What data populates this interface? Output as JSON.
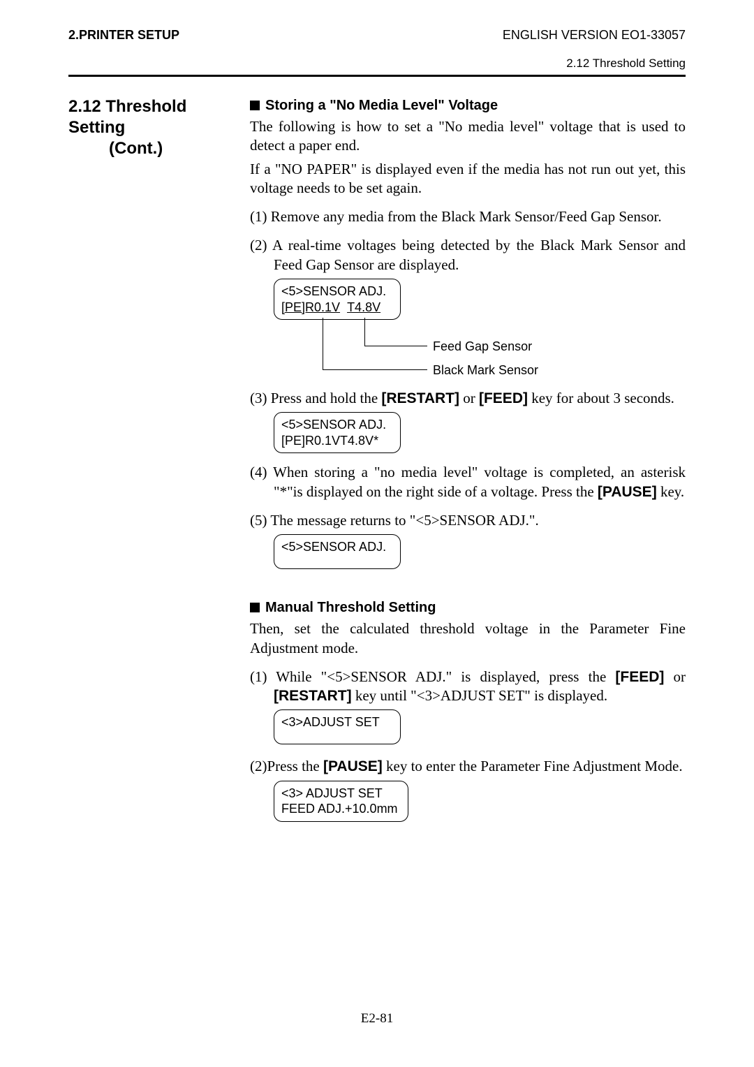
{
  "header": {
    "left": "2.PRINTER SETUP",
    "right": "ENGLISH VERSION EO1-33057",
    "sub": "2.12 Threshold Setting"
  },
  "left_col": {
    "line1": "2.12  Threshold Setting",
    "line2": "(Cont.)"
  },
  "sec1": {
    "title": "Storing a \"No Media Level\" Voltage",
    "p1": "The following is how to set a \"No media level\" voltage that is used to detect a paper end.",
    "p2": "If a \"NO PAPER\" is displayed even if the media has not run out yet, this voltage needs to be set again.",
    "s1": "(1) Remove any media from the Black Mark Sensor/Feed Gap Sensor.",
    "s2": "(2) A real-time voltages being detected by the Black Mark Sensor and Feed Gap Sensor are displayed.",
    "box2_l1": "<5>SENSOR ADJ.",
    "box2_l2a": "[PE]R0.1V",
    "box2_l2b": "T4.8V",
    "label_feed": "Feed Gap Sensor",
    "label_black": "Black Mark Sensor",
    "s3a": "(3) Press and hold the ",
    "s3b": "[RESTART]",
    "s3c": " or ",
    "s3d": "[FEED]",
    "s3e": " key for about 3 seconds.",
    "box3_l1": "<5>SENSOR ADJ.",
    "box3_l2": "[PE]R0.1VT4.8V*",
    "s4a": "(4) When storing a \"no media level\" voltage is completed, an asterisk \"*\"is displayed on the right side of a voltage.  Press the ",
    "s4b": "[PAUSE]",
    "s4c": " key.",
    "s5": "(5) The message returns to \"<5>SENSOR ADJ.\".",
    "box5_l1": "<5>SENSOR ADJ."
  },
  "sec2": {
    "title": "Manual Threshold Setting",
    "p1": "Then, set the calculated threshold voltage in the Parameter Fine Adjustment mode.",
    "s1a": "(1) While \"<5>SENSOR ADJ.\" is displayed, press the ",
    "s1b": "[FEED]",
    "s1c": " or ",
    "s1d": "[RESTART]",
    "s1e": " key until \"<3>ADJUST SET\" is displayed.",
    "box1_l1": "<3>ADJUST SET",
    "s2a": "(2)Press the ",
    "s2b": "[PAUSE]",
    "s2c": " key to enter the Parameter Fine Adjustment Mode.",
    "box2_l1": "<3> ADJUST SET",
    "box2_l2": "FEED ADJ.+10.0mm"
  },
  "footer": "E2-81"
}
